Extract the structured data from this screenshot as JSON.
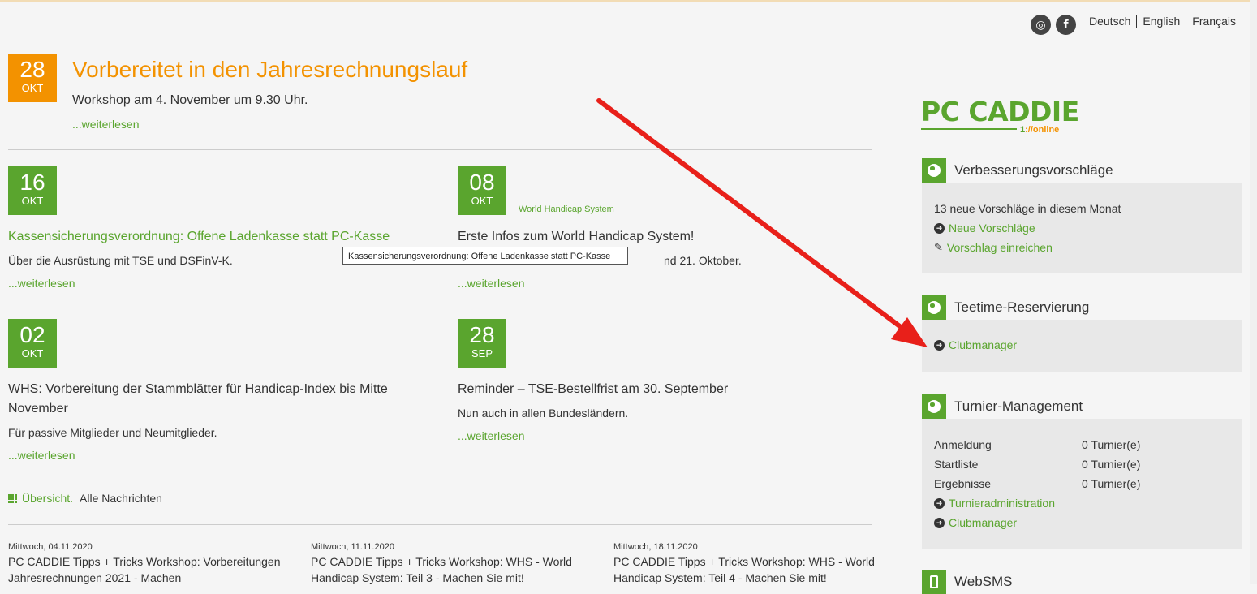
{
  "header": {
    "social": [
      {
        "icon": "instagram-icon",
        "glyph": "◎"
      },
      {
        "icon": "facebook-icon",
        "glyph": "f"
      }
    ],
    "languages": [
      "Deutsch",
      "English",
      "Français"
    ]
  },
  "featured": {
    "day": "28",
    "month": "OKT",
    "title": "Vorbereitet in den Jahresrechnungslauf",
    "subtitle": "Workshop am 4. November um 9.30 Uhr.",
    "more": "...weiterlesen"
  },
  "news": [
    {
      "day": "16",
      "month": "OKT",
      "category": "",
      "title": "Kassensicherungsverordnung: Offene Ladenkasse statt PC-Kasse",
      "text": "Über die Ausrüstung mit TSE und DSFinV-K.",
      "more": "...weiterlesen"
    },
    {
      "day": "08",
      "month": "OKT",
      "category": "World Handicap System",
      "title": "Erste Infos zum World Handicap System!",
      "text": "nd 21. Oktober.",
      "more": "...weiterlesen"
    },
    {
      "day": "02",
      "month": "OKT",
      "category": "",
      "title": "WHS: Vorbereitung der Stammblätter für Handicap-Index bis Mitte November",
      "text": "Für passive Mitglieder und Neumitglieder.",
      "more": "...weiterlesen"
    },
    {
      "day": "28",
      "month": "SEP",
      "category": "",
      "title": "Reminder – TSE-Bestellfrist am 30. September",
      "text": "Nun auch in allen Bundesländern.",
      "more": "...weiterlesen"
    }
  ],
  "tooltip": "Kassensicherungsverordnung: Offene Ladenkasse statt PC-Kasse",
  "overview": {
    "label": "Übersicht.",
    "all": "Alle Nachrichten"
  },
  "events": [
    {
      "date": "Mittwoch, 04.11.2020",
      "title": "PC CADDIE Tipps + Tricks Workshop: Vorbereitungen Jahresrechnungen 2021 - Machen"
    },
    {
      "date": "Mittwoch, 11.11.2020",
      "title": "PC CADDIE Tipps + Tricks Workshop: WHS - World Handicap System: Teil 3 - Machen Sie mit!"
    },
    {
      "date": "Mittwoch, 18.11.2020",
      "title": "PC CADDIE Tipps + Tricks Workshop: WHS - World Handicap System: Teil 4 - Machen Sie mit!"
    }
  ],
  "logo": {
    "main": "PC CADDIE",
    "online": "://online",
    "prefix": "1"
  },
  "sidebar": {
    "improvements": {
      "title": "Verbesserungsvorschläge",
      "info": "13 neue Vorschläge in diesem Monat",
      "link1": "Neue Vorschläge",
      "link2": "Vorschlag einreichen"
    },
    "teetime": {
      "title": "Teetime-Reservierung",
      "link": "Clubmanager"
    },
    "tournament": {
      "title": "Turnier-Management",
      "rows": [
        {
          "label": "Anmeldung",
          "value": "0 Turnier(e)"
        },
        {
          "label": "Startliste",
          "value": "0 Turnier(e)"
        },
        {
          "label": "Ergebnisse",
          "value": "0 Turnier(e)"
        }
      ],
      "link1": "Turnieradministration",
      "link2": "Clubmanager"
    },
    "websms": {
      "title": "WebSMS"
    }
  },
  "colors": {
    "accent": "#5aa52e",
    "orange": "#f39200",
    "arrow": "#e8201a"
  }
}
